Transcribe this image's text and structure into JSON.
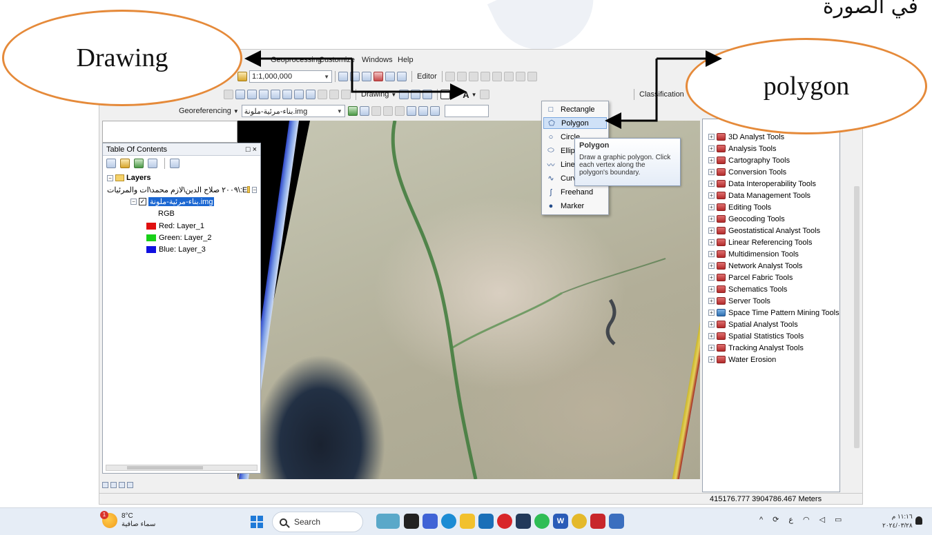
{
  "page": {
    "heading": "في الصورة"
  },
  "callouts": {
    "drawing": "Drawing",
    "polygon": "polygon"
  },
  "menubar": {
    "geoprocessing": "Geoprocessing",
    "customize": "Customize",
    "windows": "Windows",
    "help": "Help"
  },
  "toolbar": {
    "scale": "1:1,000,000",
    "editor": "Editor",
    "drawing": "Drawing",
    "font_a": "A",
    "classification": "Classification",
    "georeferencing": "Georeferencing",
    "georef_layer": "بناء-مرئية-ملونة.img"
  },
  "toc": {
    "title": "Table Of Contents",
    "close": "□ ×",
    "layers": "Layers",
    "folder_path": "E:\\٢٠٠٩ صلاح الدين\\لازم محمد\\ات والمرئيات",
    "layer_name": "بناء-مرئية-ملونة.img",
    "rgb": "RGB",
    "bands": [
      {
        "label": "Red:   Layer_1",
        "color": "#e01010"
      },
      {
        "label": "Green: Layer_2",
        "color": "#18d018"
      },
      {
        "label": "Blue:  Layer_3",
        "color": "#1010e0"
      }
    ]
  },
  "drawing_menu": {
    "items": [
      {
        "label": "Rectangle",
        "icon": "rectangle-icon",
        "glyph": "□"
      },
      {
        "label": "Polygon",
        "icon": "polygon-icon",
        "glyph": "⬠"
      },
      {
        "label": "Circle",
        "icon": "circle-icon",
        "glyph": "○"
      },
      {
        "label": "Ellipse",
        "icon": "ellipse-icon",
        "glyph": "⬭"
      },
      {
        "label": "Line",
        "icon": "line-icon",
        "glyph": "〰"
      },
      {
        "label": "Curve",
        "icon": "curve-icon",
        "glyph": "∿"
      },
      {
        "label": "Freehand",
        "icon": "freehand-icon",
        "glyph": "ʃ"
      },
      {
        "label": "Marker",
        "icon": "marker-icon",
        "glyph": "●"
      }
    ]
  },
  "tooltip": {
    "title": "Polygon",
    "body": "Draw a graphic polygon. Click each vertex along the polygon's boundary."
  },
  "catalog": {
    "tools": [
      "3D Analyst Tools",
      "Analysis Tools",
      "Cartography Tools",
      "Conversion Tools",
      "Data Interoperability Tools",
      "Data Management Tools",
      "Editing Tools",
      "Geocoding Tools",
      "Geostatistical Analyst Tools",
      "Linear Referencing Tools",
      "Multidimension Tools",
      "Network Analyst Tools",
      "Parcel Fabric Tools",
      "Schematics Tools",
      "Server Tools",
      "Space Time Pattern Mining Tools",
      "Spatial Analyst Tools",
      "Spatial Statistics Tools",
      "Tracking Analyst Tools",
      "Water Erosion"
    ]
  },
  "status": {
    "coords": "415176.777  3904786.467 Meters"
  },
  "taskbar": {
    "temp": "8°C",
    "condition": "سماء صافية",
    "weather_badge": "1",
    "search": "Search",
    "time": "١١:١٦ م",
    "date": "٢٠٢٤/٠٣/٢٨",
    "lang": "ع"
  }
}
